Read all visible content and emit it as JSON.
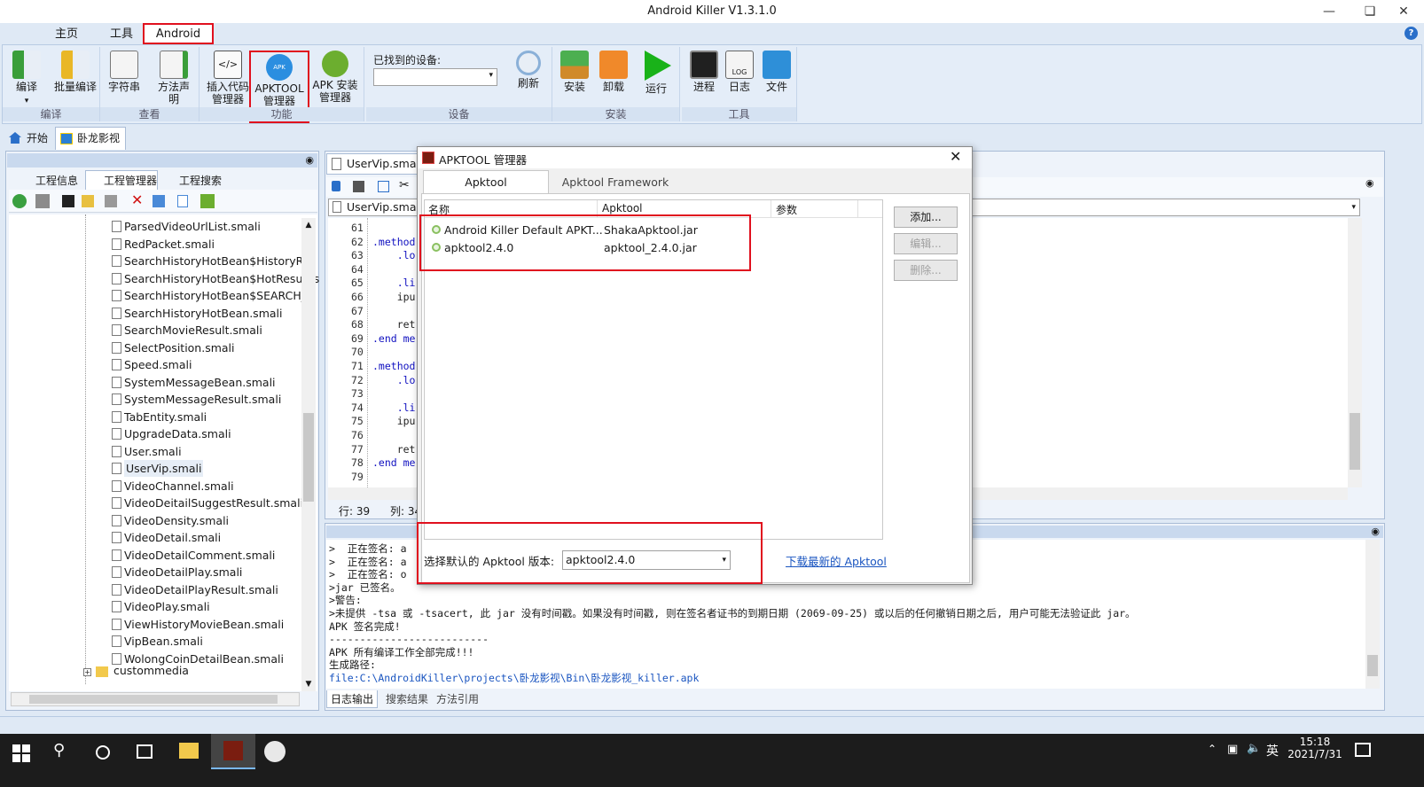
{
  "window": {
    "title": "Android Killer V1.3.1.0"
  },
  "ribbon_tabs": [
    "主页",
    "工具",
    "Android"
  ],
  "ribbon": {
    "groups": [
      {
        "label": "编译",
        "buttons": [
          "编译",
          "批量编译"
        ]
      },
      {
        "label": "查看",
        "buttons": [
          "字符串",
          "方法声明"
        ]
      },
      {
        "label": "功能",
        "buttons": [
          "插入代码管理器",
          "APKTOOL管理器",
          "APK 安装管理器"
        ]
      },
      {
        "label": "设备",
        "buttons": [
          "刷新"
        ]
      },
      {
        "label": "安装",
        "buttons": [
          "安装",
          "卸载",
          "运行"
        ]
      },
      {
        "label": "工具",
        "buttons": [
          "进程",
          "日志",
          "文件"
        ]
      }
    ],
    "device_label": "已找到的设备:"
  },
  "doc_tabs": [
    "开始",
    "卧龙影视"
  ],
  "left_tabs": [
    "工程信息",
    "工程管理器",
    "工程搜索"
  ],
  "tree_items": [
    "ParsedVideoUrlList.smali",
    "RedPacket.smali",
    "SearchHistoryHotBean$HistoryRes",
    "SearchHistoryHotBean$HotResult.s",
    "SearchHistoryHotBean$SEARCH_T",
    "SearchHistoryHotBean.smali",
    "SearchMovieResult.smali",
    "SelectPosition.smali",
    "Speed.smali",
    "SystemMessageBean.smali",
    "SystemMessageResult.smali",
    "TabEntity.smali",
    "UpgradeData.smali",
    "User.smali",
    "UserVip.smali",
    "VideoChannel.smali",
    "VideoDeitailSuggestResult.smali",
    "VideoDensity.smali",
    "VideoDetail.smali",
    "VideoDetailComment.smali",
    "VideoDetailPlay.smali",
    "VideoDetailPlayResult.smali",
    "VideoPlay.smali",
    "ViewHistoryMovieBean.smali",
    "VipBean.smali",
    "WolongCoinDetailBean.smali"
  ],
  "tree_folder": "custommedia",
  "editor": {
    "tab": "UserVip.smali",
    "file_combo": "UserVip.smali",
    "lines": [
      {
        "n": "61",
        "t": ""
      },
      {
        "n": "62",
        "t": ".method"
      },
      {
        "n": "63",
        "t": "    .lo"
      },
      {
        "n": "64",
        "t": ""
      },
      {
        "n": "65",
        "t": "    .li"
      },
      {
        "n": "66",
        "t": "    ipu"
      },
      {
        "n": "67",
        "t": ""
      },
      {
        "n": "68",
        "t": "    ret"
      },
      {
        "n": "69",
        "t": ".end me"
      },
      {
        "n": "70",
        "t": ""
      },
      {
        "n": "71",
        "t": ".method"
      },
      {
        "n": "72",
        "t": "    .lo"
      },
      {
        "n": "73",
        "t": ""
      },
      {
        "n": "74",
        "t": "    .li"
      },
      {
        "n": "75",
        "t": "    ipu"
      },
      {
        "n": "76",
        "t": ""
      },
      {
        "n": "77",
        "t": "    ret"
      },
      {
        "n": "78",
        "t": ".end me"
      },
      {
        "n": "79",
        "t": ""
      }
    ],
    "status_row": "行: 39",
    "status_col": "列: 34"
  },
  "log": {
    "lines": [
      ">  正在签名: a",
      ">  正在签名: a",
      ">  正在签名: o",
      ">jar 已签名。",
      ">警告:",
      ">未提供 -tsa 或 -tsacert, 此 jar 没有时间戳。如果没有时间戳, 则在签名者证书的到期日期 (2069-09-25) 或以后的任何撤销日期之后, 用户可能无法验证此 jar。",
      "APK 签名完成!",
      "--------------------------",
      "APK 所有编译工作全部完成!!!",
      "生成路径:"
    ],
    "link": "file:C:\\AndroidKiller\\projects\\卧龙影视\\Bin\\卧龙影视_killer.apk",
    "bottom_tabs": [
      "日志输出",
      "搜索结果",
      "方法引用"
    ]
  },
  "dialog": {
    "title": "APKTOOL 管理器",
    "tabs": [
      "Apktool",
      "Apktool Framework"
    ],
    "columns": [
      "名称",
      "Apktool",
      "参数"
    ],
    "rows": [
      {
        "name": "Android Killer Default APKT...",
        "apktool": "ShakaApktool.jar",
        "params": ""
      },
      {
        "name": "apktool2.4.0",
        "apktool": "apktool_2.4.0.jar",
        "params": ""
      }
    ],
    "buttons": [
      "添加...",
      "编辑...",
      "删除..."
    ],
    "default_label": "选择默认的 Apktool 版本:",
    "default_value": "apktool2.4.0",
    "download_link": "下载最新的 Apktool"
  },
  "taskbar": {
    "time": "15:18",
    "date": "2021/7/31",
    "ime": "英"
  },
  "colors": {
    "accent": "#e0101e",
    "ribbon_bg": "#e4edf8",
    "link": "#1a55c0"
  }
}
